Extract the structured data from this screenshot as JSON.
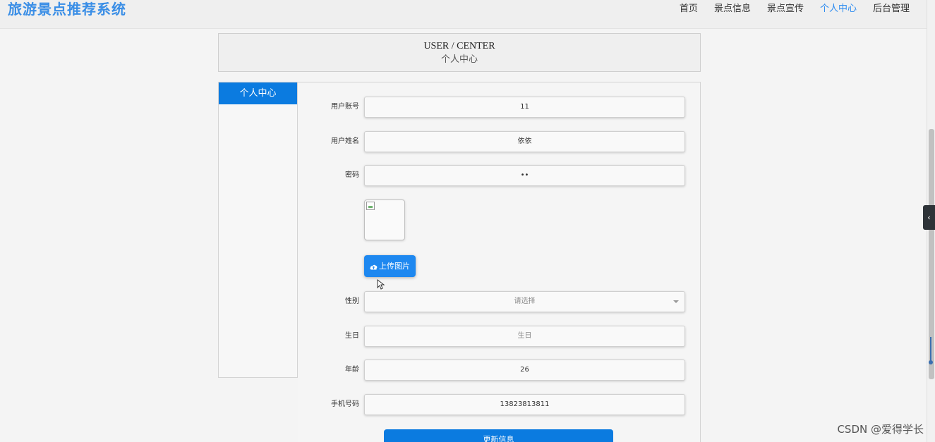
{
  "header": {
    "logo": "旅游景点推荐系统",
    "nav": [
      "首页",
      "景点信息",
      "景点宣传",
      "个人中心",
      "后台管理"
    ],
    "active_nav": "个人中心"
  },
  "title_panel": {
    "en": "USER / CENTER",
    "cn": "个人中心"
  },
  "sidebar": {
    "items": [
      "个人中心"
    ]
  },
  "form": {
    "account_label": "用户账号",
    "account_value": "11",
    "name_label": "用户姓名",
    "name_value": "依依",
    "password_label": "密码",
    "password_value": "••",
    "upload_label": "上传图片",
    "gender_label": "性别",
    "gender_placeholder": "请选择",
    "birthday_label": "生日",
    "birthday_placeholder": "生日",
    "age_label": "年龄",
    "age_value": "26",
    "phone_label": "手机号码",
    "phone_value": "13823813811",
    "submit_label": "更新信息"
  },
  "watermark": "CSDN @爱得学长",
  "colors": {
    "accent": "#0b7be0",
    "logo": "#3a8ee6",
    "active_nav": "#2c8bf0"
  },
  "icons": {
    "upload": "cloud-upload-icon",
    "collapse": "chevron-left-icon",
    "select": "chevron-down-icon",
    "avatar": "broken-image-icon"
  }
}
